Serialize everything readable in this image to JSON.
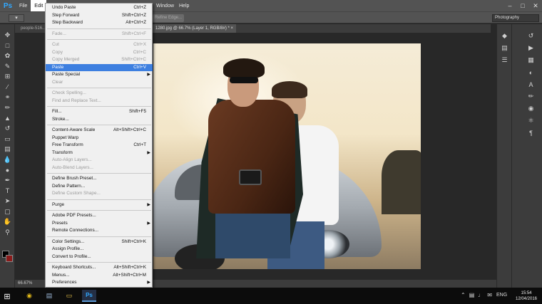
{
  "app": {
    "logo": "Ps",
    "menus": [
      "File",
      "Edit"
    ],
    "menus_right": [
      "Window",
      "Help"
    ],
    "active_menu": "Edit"
  },
  "options_bar": {
    "refine_edge": "Refine Edge...",
    "workspace": "Photography"
  },
  "tabs": [
    {
      "label": "people-516..."
    },
    {
      "label": "1280.jpg @ 66.7% (Layer 1, RGB/8#) * ×"
    }
  ],
  "status": {
    "zoom": "66.67%"
  },
  "edit_menu": {
    "items": [
      {
        "label": "Undo Paste",
        "shortcut": "Ctrl+Z",
        "enabled": true
      },
      {
        "label": "Step Forward",
        "shortcut": "Shift+Ctrl+Z",
        "enabled": true
      },
      {
        "label": "Step Backward",
        "shortcut": "Alt+Ctrl+Z",
        "enabled": true
      },
      {
        "sep": true
      },
      {
        "label": "Fade...",
        "shortcut": "Shift+Ctrl+F",
        "enabled": false
      },
      {
        "sep": true
      },
      {
        "label": "Cut",
        "shortcut": "Ctrl+X",
        "enabled": false
      },
      {
        "label": "Copy",
        "shortcut": "Ctrl+C",
        "enabled": false
      },
      {
        "label": "Copy Merged",
        "shortcut": "Shift+Ctrl+C",
        "enabled": false
      },
      {
        "label": "Paste",
        "shortcut": "Ctrl+V",
        "enabled": true,
        "selected": true
      },
      {
        "label": "Paste Special",
        "submenu": true,
        "enabled": true
      },
      {
        "label": "Clear",
        "enabled": false
      },
      {
        "sep": true
      },
      {
        "label": "Check Spelling...",
        "enabled": false
      },
      {
        "label": "Find and Replace Text...",
        "enabled": false
      },
      {
        "sep": true
      },
      {
        "label": "Fill...",
        "shortcut": "Shift+F5",
        "enabled": true
      },
      {
        "label": "Stroke...",
        "enabled": true
      },
      {
        "sep": true
      },
      {
        "label": "Content-Aware Scale",
        "shortcut": "Alt+Shift+Ctrl+C",
        "enabled": true
      },
      {
        "label": "Puppet Warp",
        "enabled": true
      },
      {
        "label": "Free Transform",
        "shortcut": "Ctrl+T",
        "enabled": true
      },
      {
        "label": "Transform",
        "submenu": true,
        "enabled": true
      },
      {
        "label": "Auto-Align Layers...",
        "enabled": false
      },
      {
        "label": "Auto-Blend Layers...",
        "enabled": false
      },
      {
        "sep": true
      },
      {
        "label": "Define Brush Preset...",
        "enabled": true
      },
      {
        "label": "Define Pattern...",
        "enabled": true
      },
      {
        "label": "Define Custom Shape...",
        "enabled": false
      },
      {
        "sep": true
      },
      {
        "label": "Purge",
        "submenu": true,
        "enabled": true
      },
      {
        "sep": true
      },
      {
        "label": "Adobe PDF Presets...",
        "enabled": true
      },
      {
        "label": "Presets",
        "submenu": true,
        "enabled": true
      },
      {
        "label": "Remote Connections...",
        "enabled": true
      },
      {
        "sep": true
      },
      {
        "label": "Color Settings...",
        "shortcut": "Shift+Ctrl+K",
        "enabled": true
      },
      {
        "label": "Assign Profile...",
        "enabled": true
      },
      {
        "label": "Convert to Profile...",
        "enabled": true
      },
      {
        "sep": true
      },
      {
        "label": "Keyboard Shortcuts...",
        "shortcut": "Alt+Shift+Ctrl+K",
        "enabled": true
      },
      {
        "label": "Menus...",
        "shortcut": "Alt+Shift+Ctrl+M",
        "enabled": true
      },
      {
        "label": "Preferences",
        "submenu": true,
        "enabled": true
      }
    ]
  },
  "taskbar": {
    "lang": "ENG",
    "time": "15:54",
    "date": "12/04/2016"
  },
  "icons": {
    "tools": [
      "move-icon",
      "marquee-icon",
      "lasso-icon",
      "quick-select-icon",
      "crop-icon",
      "eyedropper-icon",
      "healing-icon",
      "brush-icon",
      "stamp-icon",
      "history-brush-icon",
      "eraser-icon",
      "gradient-icon",
      "blur-icon",
      "dodge-icon",
      "pen-icon",
      "type-icon",
      "path-select-icon",
      "shape-icon",
      "hand-icon",
      "zoom-icon"
    ]
  }
}
